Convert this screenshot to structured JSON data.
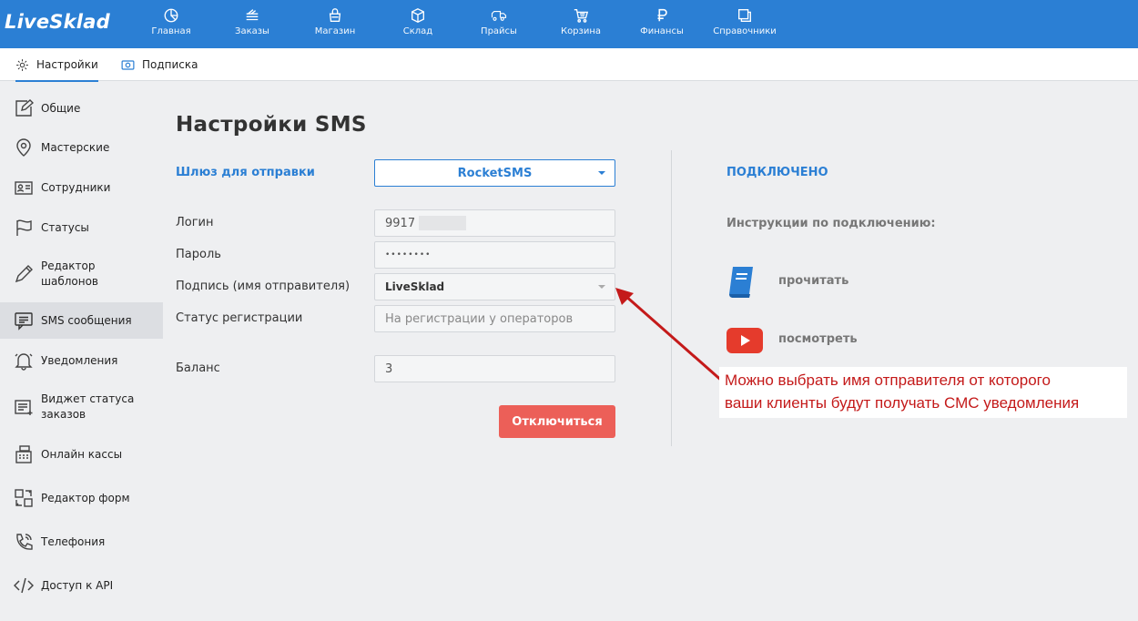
{
  "app": {
    "logo": "LiveSklad"
  },
  "nav": [
    {
      "label": "Главная",
      "icon": "home-icon"
    },
    {
      "label": "Заказы",
      "icon": "orders-icon"
    },
    {
      "label": "Магазин",
      "icon": "shop-icon"
    },
    {
      "label": "Склад",
      "icon": "warehouse-icon"
    },
    {
      "label": "Прайсы",
      "icon": "prices-icon"
    },
    {
      "label": "Корзина",
      "icon": "cart-icon"
    },
    {
      "label": "Финансы",
      "icon": "ruble-icon"
    },
    {
      "label": "Справочники",
      "icon": "directory-icon"
    }
  ],
  "subtabs": [
    {
      "label": "Настройки",
      "icon": "gear-icon"
    },
    {
      "label": "Подписка",
      "icon": "subscription-icon"
    }
  ],
  "sidebar": [
    {
      "label": "Общие",
      "icon": "edit-icon"
    },
    {
      "label": "Мастерские",
      "icon": "location-pin-icon"
    },
    {
      "label": "Сотрудники",
      "icon": "id-card-icon"
    },
    {
      "label": "Статусы",
      "icon": "flag-icon"
    },
    {
      "label": "Редактор шаблонов",
      "line1": "Редактор",
      "line2": "шаблонов",
      "icon": "pen-icon"
    },
    {
      "label": "SMS сообщения",
      "icon": "message-icon"
    },
    {
      "label": "Уведомления",
      "icon": "bell-icon"
    },
    {
      "label": "Виджет статуса заказов",
      "line1": "Виджет статуса",
      "line2": "заказов",
      "icon": "widget-icon"
    },
    {
      "label": "Онлайн кассы",
      "icon": "cash-register-icon"
    },
    {
      "label": "Редактор форм",
      "icon": "form-editor-icon"
    },
    {
      "label": "Телефония",
      "icon": "phone-icon"
    },
    {
      "label": "Доступ к API",
      "icon": "code-icon"
    }
  ],
  "main": {
    "title": "Настройки SMS",
    "gateway_label": "Шлюз для отправки",
    "gateway_value": "RocketSMS",
    "login_label": "Логин",
    "login_value": "9917",
    "password_label": "Пароль",
    "password_value": "••••••••",
    "signature_label": "Подпись (имя отправителя)",
    "signature_value": "LiveSklad",
    "reg_status_label": "Статус регистрации",
    "reg_status_placeholder": "На регистрации у операторов",
    "balance_label": "Баланс",
    "balance_value": "3",
    "disconnect_button": "Отключиться"
  },
  "right": {
    "status": "ПОДКЛЮЧЕНО",
    "instructions": "Инструкции по подключению:",
    "read_label": "прочитать",
    "watch_label": "посмотреть"
  },
  "annotation": {
    "line1": "Можно выбрать имя отправителя от которого",
    "line2": "ваши клиенты будут получать СМС уведомления",
    "color": "#c41a1a"
  },
  "colors": {
    "brand": "#2b7fd4",
    "danger": "#ec5f58"
  }
}
